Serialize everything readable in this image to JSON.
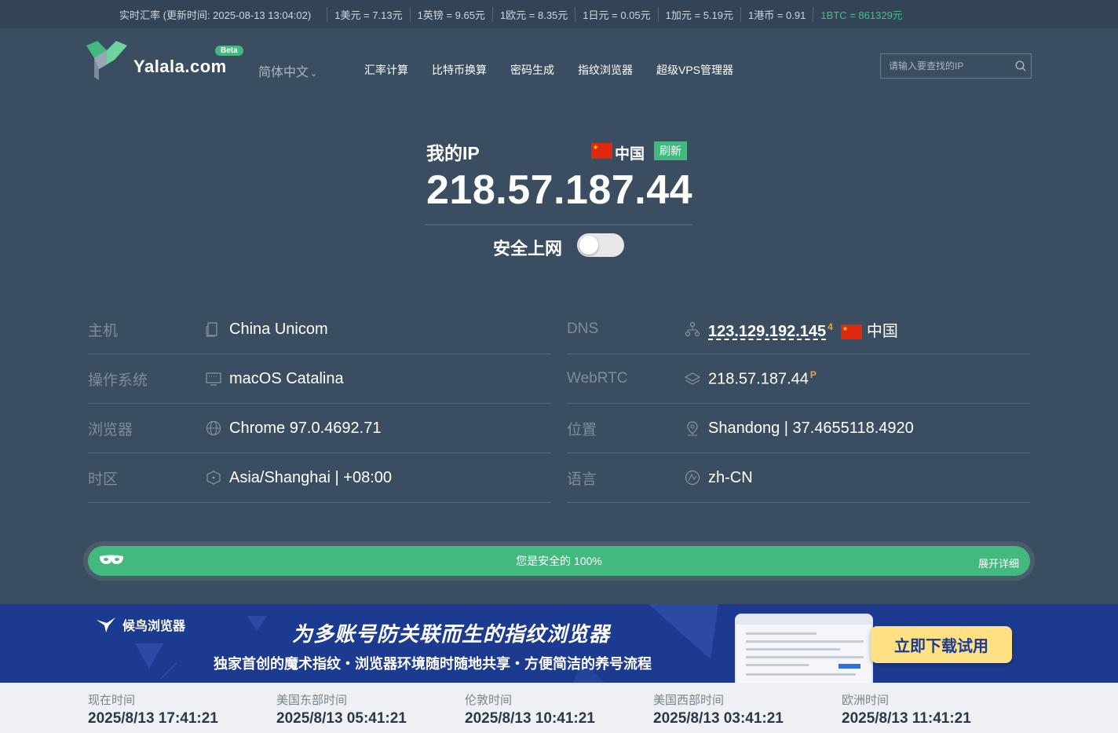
{
  "ticker": {
    "update_time": "实时汇率 (更新时间: 2025-08-13 13:04:02)",
    "rates": [
      "1美元 = 7.13元",
      "1英镑 = 9.65元",
      "1欧元 = 8.35元",
      "1日元 = 0.05元",
      "1加元 = 5.19元",
      "1港币 = 0.91"
    ],
    "btc": "1BTC = 861329元"
  },
  "header": {
    "brand": "Yalala.com",
    "beta": "Beta",
    "language": "简体中文",
    "nav": [
      "汇率计算",
      "比特币换算",
      "密码生成",
      "指纹浏览器",
      "超级VPS管理器"
    ],
    "search_placeholder": "请输入要查找的IP"
  },
  "hero": {
    "my_ip_label": "我的IP",
    "country": "中国",
    "refresh": "刷新",
    "ip": "218.57.187.44",
    "safe_browsing": "安全上网",
    "safe_browsing_on": false
  },
  "info_left": [
    {
      "label": "主机",
      "icon": "server-icon",
      "value": "China Unicom"
    },
    {
      "label": "操作系统",
      "icon": "monitor-icon",
      "value": "macOS Catalina"
    },
    {
      "label": "浏览器",
      "icon": "globe-icon",
      "value": "Chrome 97.0.4692.71"
    },
    {
      "label": "时区",
      "icon": "hexagon-icon",
      "value": "Asia/Shanghai | +08:00"
    }
  ],
  "info_right": {
    "dns": {
      "label": "DNS",
      "icon": "network-icon",
      "value": "123.129.192.145",
      "sup": "4",
      "country": "中国"
    },
    "webrtc": {
      "label": "WebRTC",
      "icon": "layers-icon",
      "value": "218.57.187.44",
      "sup": "P"
    },
    "location": {
      "label": "位置",
      "icon": "pin-icon",
      "value": "Shandong | 37.4655118.4920"
    },
    "language": {
      "label": "语言",
      "icon": "language-icon",
      "value": "zh-CN"
    }
  },
  "safety": {
    "text": "您是安全的 100%",
    "percent": 100,
    "expand": "展开详细"
  },
  "banner": {
    "brand": "候鸟浏览器",
    "title": "为多账号防关联而生的指纹浏览器",
    "subtitle": "独家首创的魔术指纹・浏览器环境随时随地共享・方便简洁的养号流程",
    "cta": "立即下载试用"
  },
  "times": [
    {
      "label": "现在时间",
      "value": "2025/8/13 17:41:21"
    },
    {
      "label": "美国东部时间",
      "value": "2025/8/13 05:41:21"
    },
    {
      "label": "伦敦时间",
      "value": "2025/8/13 10:41:21"
    },
    {
      "label": "美国西部时间",
      "value": "2025/8/13 03:41:21"
    },
    {
      "label": "欧洲时间",
      "value": "2025/8/13 11:41:21"
    }
  ],
  "colors": {
    "accent": "#43b97f",
    "background": "#3b4d60",
    "banner": "#1c3a8f",
    "cta": "#ffe082"
  }
}
